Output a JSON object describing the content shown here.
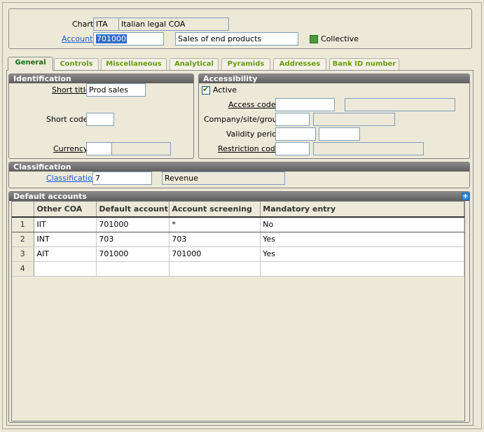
{
  "header": {
    "chart_label": "Chart",
    "chart_code": "ITA",
    "chart_desc": "Italian legal COA",
    "account_label": "Account",
    "account_value": "701000",
    "account_desc": "Sales of end products",
    "collective_label": "Collective"
  },
  "tabs": [
    {
      "label": "General"
    },
    {
      "label": "Controls"
    },
    {
      "label": "Miscellaneous"
    },
    {
      "label": "Analytical"
    },
    {
      "label": "Pyramids"
    },
    {
      "label": "Addresses"
    },
    {
      "label": "Bank ID number"
    }
  ],
  "identification": {
    "title": "Identification",
    "short_title_label": "Short title",
    "short_title_value": "Prod sales",
    "short_code_label": "Short code",
    "short_code_value": "",
    "currency_label": "Currency",
    "currency_value": ""
  },
  "accessibility": {
    "title": "Accessibility",
    "active_label": "Active",
    "access_code_label": "Access code",
    "company_label": "Company/site/group",
    "validity_label": "Validity period",
    "restriction_label": "Restriction code"
  },
  "classification": {
    "title": "Classification",
    "label": "Classification",
    "value": "7",
    "desc": "Revenue"
  },
  "default_accounts": {
    "title": "Default accounts",
    "columns": [
      "Other COA",
      "Default account",
      "Account screening",
      "Mandatory entry"
    ],
    "rows": [
      {
        "num": "1",
        "coa": "IIT",
        "account": "701000",
        "screening": "*",
        "mandatory": "No"
      },
      {
        "num": "2",
        "coa": "INT",
        "account": "703",
        "screening": "703",
        "mandatory": "Yes"
      },
      {
        "num": "3",
        "coa": "AIT",
        "account": "701000",
        "screening": "701000",
        "mandatory": "Yes"
      },
      {
        "num": "4",
        "coa": "",
        "account": "",
        "screening": "",
        "mandatory": ""
      }
    ]
  },
  "colors": {
    "tab_text": "#6b9a10",
    "link": "#1a5fd6",
    "selection": "#316ac5"
  }
}
